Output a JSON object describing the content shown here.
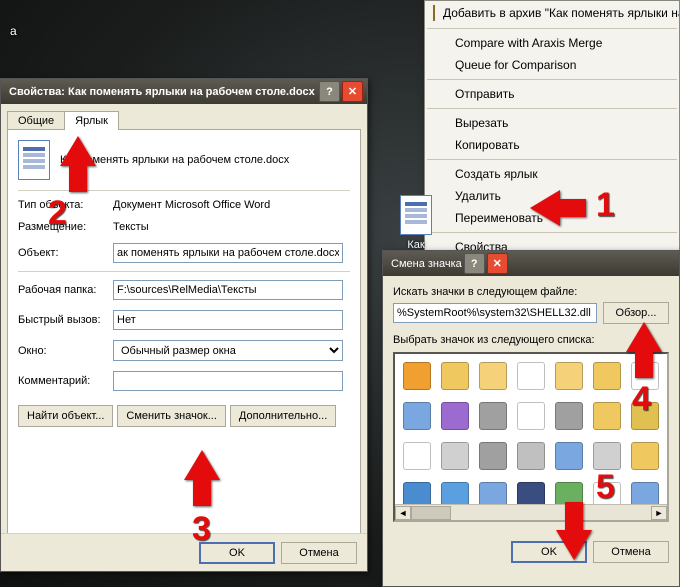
{
  "desktop": {
    "label": "а"
  },
  "properties": {
    "title": "Свойства: Как поменять ярлыки на рабочем столе.docx",
    "tabs": {
      "general": "Общие",
      "shortcut": "Ярлык"
    },
    "filename": "Как поменять ярлыки на рабочем столе.docx",
    "rows": {
      "type_label": "Тип объекта:",
      "type_value": "Документ Microsoft Office Word",
      "location_label": "Размещение:",
      "location_value": "Тексты",
      "target_label": "Объект:",
      "target_value": "ак поменять ярлыки на рабочем столе.docx\"",
      "startin_label": "Рабочая папка:",
      "startin_value": "F:\\sources\\RelMedia\\Тексты",
      "hotkey_label": "Быстрый вызов:",
      "hotkey_value": "Нет",
      "run_label": "Окно:",
      "run_value": "Обычный размер окна",
      "comment_label": "Комментарий:",
      "comment_value": ""
    },
    "buttons": {
      "find": "Найти объект...",
      "change_icon": "Сменить значок...",
      "advanced": "Дополнительно..."
    },
    "footer": {
      "ok": "OK",
      "cancel": "Отмена"
    }
  },
  "context_menu": {
    "items": {
      "add_archive": "Добавить в архив \"Как поменять ярлыки на ра",
      "araxis_compare": "Compare with Araxis Merge",
      "araxis_queue": "Queue for Comparison",
      "send_to": "Отправить",
      "cut": "Вырезать",
      "copy": "Копировать",
      "create_shortcut": "Создать ярлык",
      "delete": "Удалить",
      "rename": "Переименовать",
      "properties": "Свойства"
    }
  },
  "desktop_file": {
    "caption": "Как поменять"
  },
  "change_icon": {
    "title": "Смена значка",
    "search_label": "Искать значки в следующем файле:",
    "path": "%SystemRoot%\\system32\\SHELL32.dll",
    "browse": "Обзор...",
    "list_label": "Выбрать значок из следующего списка:",
    "footer": {
      "ok": "OK",
      "cancel": "Отмена"
    }
  },
  "icons_palette": [
    "#f0a030",
    "#f0c860",
    "#f5d27a",
    "#ffffff",
    "#f5d27a",
    "#f0c860",
    "#ffffff",
    "#7aa7e0",
    "#9c6bd0",
    "#a0a0a0",
    "#ffffff",
    "#a0a0a0",
    "#f0c860",
    "#e0c050",
    "#ffffff",
    "#d0d0d0",
    "#a0a0a0",
    "#c0c0c0",
    "#7aa7e0",
    "#d0d0d0",
    "#f0c860",
    "#4a8cd0",
    "#5aa0e0",
    "#7aa7e0",
    "#3a4d80",
    "#6ab060",
    "#ffffff",
    "#7aa7e0",
    "#f0c860",
    "#d0d0d0",
    "#d0d0d0",
    "#c0c0c0",
    "#d0d0d0",
    "#b0a070",
    "#c0c0c0"
  ],
  "callouts": {
    "n1": "1",
    "n2": "2",
    "n3": "3",
    "n4": "4",
    "n5": "5"
  }
}
